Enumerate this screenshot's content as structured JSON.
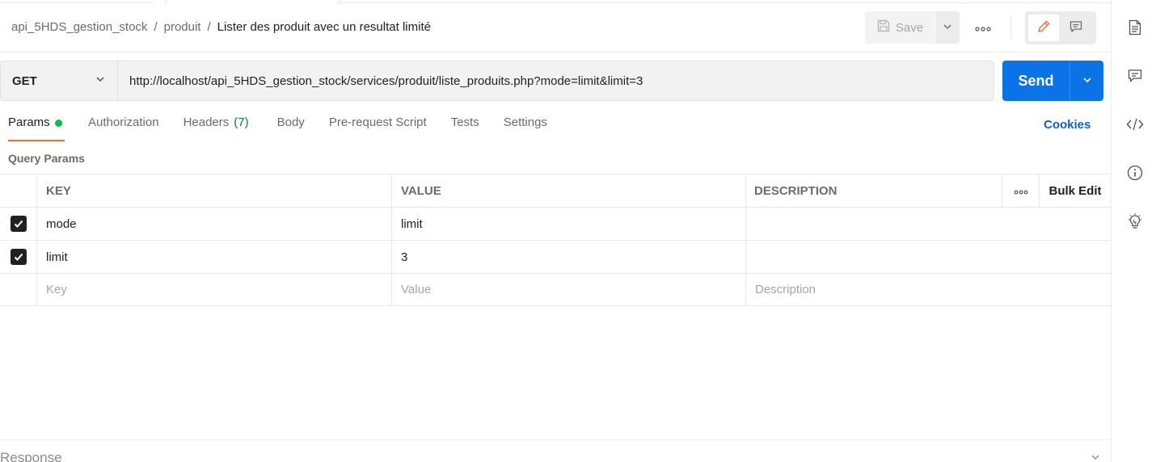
{
  "breadcrumb": {
    "collection": "api_5HDS_gestion_stock",
    "folder": "produit",
    "request": "Lister des produit avec un resultat limité",
    "separator": "/"
  },
  "toolbar": {
    "save_label": "Save"
  },
  "request": {
    "method": "GET",
    "url": "http://localhost/api_5HDS_gestion_stock/services/produit/liste_produits.php?mode=limit&limit=3",
    "send_label": "Send"
  },
  "tabs": [
    {
      "label": "Params",
      "active": true
    },
    {
      "label": "Authorization"
    },
    {
      "label": "Headers",
      "count": "(7)"
    },
    {
      "label": "Body"
    },
    {
      "label": "Pre-request Script"
    },
    {
      "label": "Tests"
    },
    {
      "label": "Settings"
    }
  ],
  "cookies_label": "Cookies",
  "query_params": {
    "title": "Query Params",
    "columns": {
      "key": "KEY",
      "value": "VALUE",
      "description": "DESCRIPTION",
      "bulk_edit": "Bulk Edit"
    },
    "rows": [
      {
        "checked": true,
        "key": "mode",
        "value": "limit",
        "description": ""
      },
      {
        "checked": true,
        "key": "limit",
        "value": "3",
        "description": ""
      }
    ],
    "placeholders": {
      "key": "Key",
      "value": "Value",
      "description": "Description"
    }
  },
  "response_label": "Response",
  "colors": {
    "accent_orange": "#f26b3a",
    "send_blue": "#0b73e5",
    "link_blue": "#0b5fcf",
    "status_green": "#0cbb52"
  },
  "icons": {
    "right_sidebar": [
      "document-icon",
      "comment-icon",
      "code-icon",
      "info-icon",
      "lightbulb-icon"
    ]
  }
}
